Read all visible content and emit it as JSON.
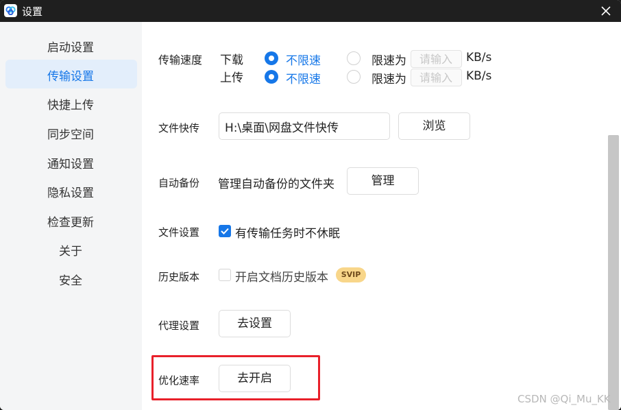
{
  "window": {
    "title": "设置"
  },
  "sidebar": {
    "items": [
      {
        "label": "启动设置",
        "active": false
      },
      {
        "label": "传输设置",
        "active": true
      },
      {
        "label": "快捷上传",
        "active": false
      },
      {
        "label": "同步空间",
        "active": false
      },
      {
        "label": "通知设置",
        "active": false
      },
      {
        "label": "隐私设置",
        "active": false
      },
      {
        "label": "检查更新",
        "active": false
      },
      {
        "label": "关于",
        "active": false
      },
      {
        "label": "安全",
        "active": false
      }
    ]
  },
  "transfer_speed": {
    "label": "传输速度",
    "download": {
      "label": "下载",
      "unlimited_label": "不限速",
      "limit_label": "限速为",
      "placeholder": "请输入",
      "unit": "KB/s",
      "selected": "unlimited"
    },
    "upload": {
      "label": "上传",
      "unlimited_label": "不限速",
      "limit_label": "限速为",
      "placeholder": "请输入",
      "unit": "KB/s",
      "selected": "unlimited"
    }
  },
  "quick_transfer": {
    "label": "文件快传",
    "path_value": "H:\\桌面\\网盘文件快传",
    "browse_label": "浏览"
  },
  "auto_backup": {
    "label": "自动备份",
    "description": "管理自动备份的文件夹",
    "manage_label": "管理"
  },
  "file_settings": {
    "label": "文件设置",
    "checkbox_label": "有传输任务时不休眠",
    "checked": true
  },
  "history_version": {
    "label": "历史版本",
    "checkbox_label": "开启文档历史版本",
    "checked": false,
    "badge": "SVIP"
  },
  "proxy": {
    "label": "代理设置",
    "button_label": "去设置"
  },
  "speed_optimize": {
    "label": "优化速率",
    "button_label": "去开启"
  },
  "watermark": "CSDN @Qi_Mu_KK",
  "colors": {
    "accent": "#1677e8",
    "titlebar": "#1f1f1f",
    "highlight": "#e8202a",
    "svip_badge": "#f8d68a"
  }
}
